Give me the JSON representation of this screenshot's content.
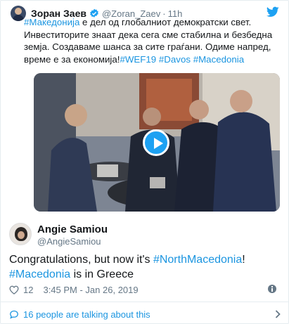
{
  "quoted_tweet": {
    "author_name": "Зоран Заев",
    "handle": "@Zoran_Zaev",
    "separator": "·",
    "time": "11h",
    "text_segments": [
      {
        "text": "#Македонија",
        "type": "hashtag"
      },
      {
        "text": " е дел од глобалниот демократски свет. Инвеститорите знаат дека сега сме стабилна и безбедна земја. Создаваме шанса за сите граѓани. Одиме напред, време е за економија!",
        "type": "text"
      },
      {
        "text": "#WEF19",
        "type": "hashtag"
      },
      {
        "text": " ",
        "type": "text"
      },
      {
        "text": "#Davos",
        "type": "hashtag"
      },
      {
        "text": " ",
        "type": "text"
      },
      {
        "text": "#Macedonia",
        "type": "hashtag"
      }
    ]
  },
  "reply_tweet": {
    "author_name": "Angie Samiou",
    "handle": "@AngieSamiou",
    "text_segments": [
      {
        "text": "Congratulations, but now it's ",
        "type": "text"
      },
      {
        "text": "#NorthMacedonia",
        "type": "hashtag"
      },
      {
        "text": "! ",
        "type": "text"
      },
      {
        "text": "#Macedonia",
        "type": "hashtag"
      },
      {
        "text": " is in Greece",
        "type": "text"
      }
    ],
    "likes": "12",
    "timestamp": "3:45 PM - Jan 26, 2019"
  },
  "footer": {
    "talking_label": "16 people are talking about this"
  },
  "icons": {
    "verified": "verified-badge-icon",
    "brand": "twitter-bird-icon",
    "play": "play-icon",
    "like": "heart-icon",
    "info": "info-icon",
    "conversation": "speech-bubble-icon",
    "chevron": "chevron-right-icon"
  },
  "colors": {
    "link": "#1b95e0",
    "brand": "#1da1f2",
    "muted": "#657786",
    "text": "#14171a",
    "border": "#e6ecf0"
  }
}
